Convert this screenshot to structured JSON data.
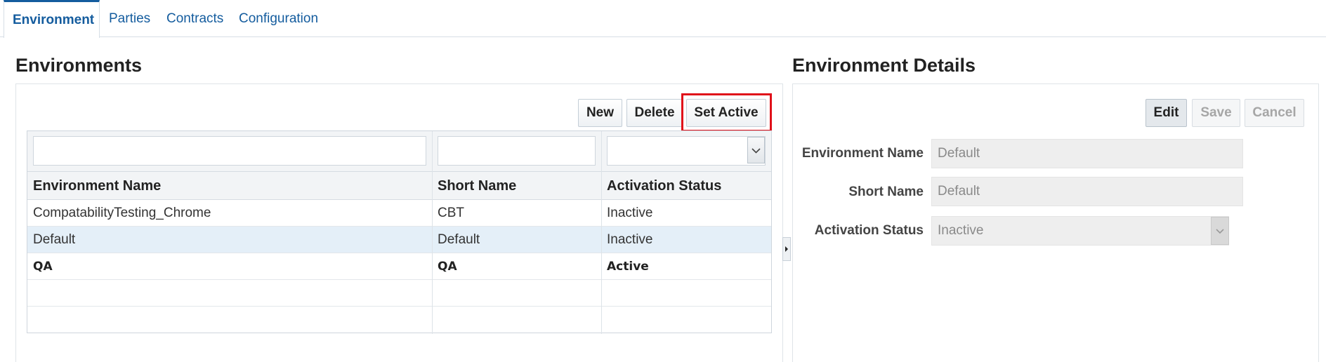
{
  "tabs": [
    {
      "label": "Environment",
      "active": true
    },
    {
      "label": "Parties",
      "active": false
    },
    {
      "label": "Contracts",
      "active": false
    },
    {
      "label": "Configuration",
      "active": false
    }
  ],
  "environments": {
    "title": "Environments",
    "toolbar": {
      "new_label": "New",
      "delete_label": "Delete",
      "set_active_label": "Set Active"
    },
    "table": {
      "columns": [
        "Environment Name",
        "Short Name",
        "Activation Status"
      ],
      "rows": [
        {
          "name": "CompatabilityTesting_Chrome",
          "short": "CBT",
          "status": "Inactive"
        },
        {
          "name": "Default",
          "short": "Default",
          "status": "Inactive"
        },
        {
          "name": "QA",
          "short": "QA",
          "status": "Active"
        }
      ]
    }
  },
  "details": {
    "title": "Environment Details",
    "toolbar": {
      "edit_label": "Edit",
      "save_label": "Save",
      "cancel_label": "Cancel"
    },
    "fields": {
      "environment_name_label": "Environment Name",
      "environment_name_value": "Default",
      "short_name_label": "Short Name",
      "short_name_value": "Default",
      "activation_status_label": "Activation Status",
      "activation_status_value": "Inactive"
    }
  },
  "colors": {
    "accent": "#145c9e",
    "highlight": "#e0101a",
    "selected_row": "#e4eff8"
  },
  "icons": {
    "filter_dropdown": "chevron-down-icon",
    "status_dropdown": "chevron-down-icon",
    "splitter": "caret-right-icon"
  }
}
